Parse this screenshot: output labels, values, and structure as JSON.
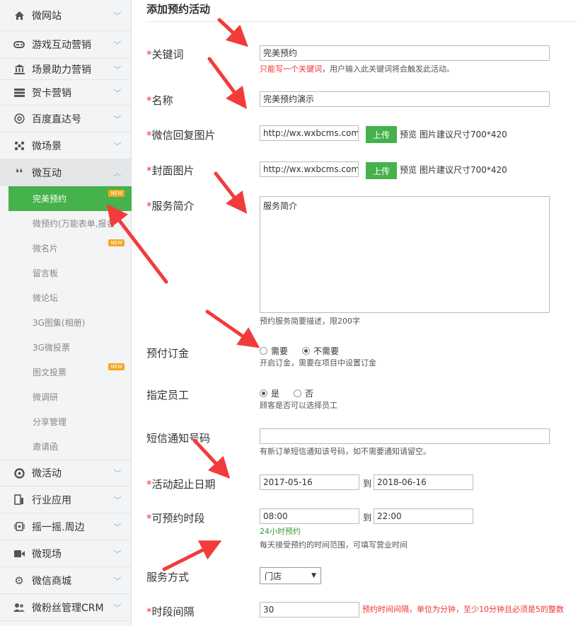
{
  "sidebar": {
    "items": [
      {
        "label": "微网站",
        "icon": "home-icon"
      },
      {
        "label": "游戏互动营销",
        "icon": "gamepad-icon"
      },
      {
        "label": "场景助力营销",
        "icon": "bank-icon"
      },
      {
        "label": "贺卡营销",
        "icon": "card-icon"
      },
      {
        "label": "百度直达号",
        "icon": "at-icon"
      },
      {
        "label": "微场景",
        "icon": "scene-icon"
      },
      {
        "label": "微互动",
        "icon": "quote-icon"
      }
    ],
    "subitems": [
      {
        "label": "完美预约",
        "badge": "NEW"
      },
      {
        "label": "微预约(万能表单,报名",
        "badge": ""
      },
      {
        "label": "微名片",
        "badge": "NEW"
      },
      {
        "label": "留言板",
        "badge": ""
      },
      {
        "label": "微论坛",
        "badge": ""
      },
      {
        "label": "3G图集(相册)",
        "badge": ""
      },
      {
        "label": "3G微投票",
        "badge": ""
      },
      {
        "label": "图文投票",
        "badge": "NEW"
      },
      {
        "label": "微调研",
        "badge": ""
      },
      {
        "label": "分享管理",
        "badge": ""
      },
      {
        "label": "邀请函",
        "badge": ""
      }
    ],
    "bottom_items": [
      {
        "label": "微活动",
        "icon": "activity-icon"
      },
      {
        "label": "行业应用",
        "icon": "industry-icon"
      },
      {
        "label": "摇一摇.周边",
        "icon": "shake-icon"
      },
      {
        "label": "微现场",
        "icon": "video-icon"
      },
      {
        "label": "微信商城",
        "icon": "gear-icon"
      },
      {
        "label": "微粉丝管理CRM",
        "icon": "users-icon"
      }
    ]
  },
  "form": {
    "title": "添加预约活动",
    "keyword": {
      "label": "关键词",
      "value": "完美预约",
      "hint_red": "只能写一个关键词",
      "hint": "，用户输入此关键词将会触发此活动。"
    },
    "name": {
      "label": "名称",
      "value": "完美预约演示"
    },
    "reply_image": {
      "label": "微信回复图片",
      "value": "http://wx.wxbcms.com/",
      "upload": "上传",
      "preview": "预览",
      "tip": "图片建议尺寸700*420"
    },
    "cover_image": {
      "label": "封面图片",
      "value": "http://wx.wxbcms.com/",
      "upload": "上传",
      "preview": "预览",
      "tip": "图片建议尺寸700*420"
    },
    "intro": {
      "label": "服务简介",
      "value": "服务简介",
      "hint": "预约服务简要描述，限200字"
    },
    "deposit": {
      "label": "预付订金",
      "opt1": "需要",
      "opt2": "不需要",
      "hint": "开启订金，需要在项目中设置订金"
    },
    "staff": {
      "label": "指定员工",
      "opt1": "是",
      "opt2": "否",
      "hint": "顾客是否可以选择员工"
    },
    "sms": {
      "label": "短信通知号码",
      "value": "",
      "hint": "有新订单短信通知该号码，如不需要通知请留空。"
    },
    "date_range": {
      "label": "活动起止日期",
      "start": "2017-05-16",
      "to": "到",
      "end": "2018-06-16"
    },
    "time_range": {
      "label": "可预约时段",
      "start": "08:00",
      "to": "到",
      "end": "22:00",
      "hint_green": "24小时预约",
      "hint": "每天接受预约的时间范围，可填写营业时间"
    },
    "service_mode": {
      "label": "服务方式",
      "value": "门店"
    },
    "interval": {
      "label": "时段间隔",
      "value": "30",
      "hint_red": "预约时间间隔，单位为分钟，至少10分钟且必须是5的整数"
    }
  }
}
